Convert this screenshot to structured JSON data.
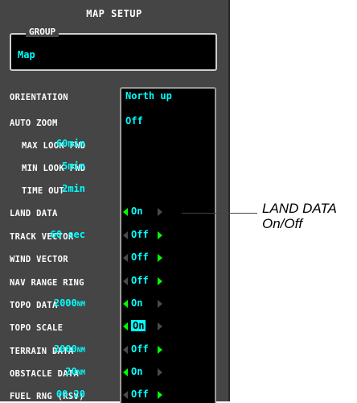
{
  "panel": {
    "title": "MAP SETUP",
    "group": {
      "label": "GROUP",
      "value": "Map"
    }
  },
  "settings": {
    "orientation": {
      "label": "ORIENTATION",
      "value": "North up"
    },
    "auto_zoom": {
      "label": "AUTO ZOOM",
      "value": "Off"
    },
    "max_look_fwd": {
      "label": "MAX LOOK FWD",
      "value": "60min"
    },
    "min_look_fwd": {
      "label": "MIN LOOK FWD",
      "value": "5min"
    },
    "time_out": {
      "label": "TIME OUT",
      "value": "2min"
    },
    "land_data": {
      "label": "LAND DATA",
      "value": "On"
    },
    "track_vector": {
      "label": "TRACK VECTOR",
      "value": "Off",
      "range": "60 sec"
    },
    "wind_vector": {
      "label": "WIND VECTOR",
      "value": "Off"
    },
    "nav_range_ring": {
      "label": "NAV RANGE RING",
      "value": "Off"
    },
    "topo_data": {
      "label": "TOPO DATA",
      "value": "On",
      "range": "2000",
      "unit": "NM"
    },
    "topo_scale": {
      "label": "TOPO SCALE",
      "value": "On"
    },
    "terrain_data": {
      "label": "TERRAIN DATA",
      "value": "Off",
      "range": "2000",
      "unit": "NM"
    },
    "obstacle_data": {
      "label": "OBSTACLE DATA",
      "value": "On",
      "range": "20",
      "unit": "NM"
    },
    "fuel_rng": {
      "label": "FUEL RNG (RSV)",
      "value": "Off",
      "range": "00:20"
    }
  },
  "callout": {
    "line1": "LAND DATA",
    "line2": "On/Off"
  },
  "colors": {
    "panel_bg": "#454545",
    "value_cyan": "#00ffff",
    "arrow_green": "#00ff00"
  }
}
